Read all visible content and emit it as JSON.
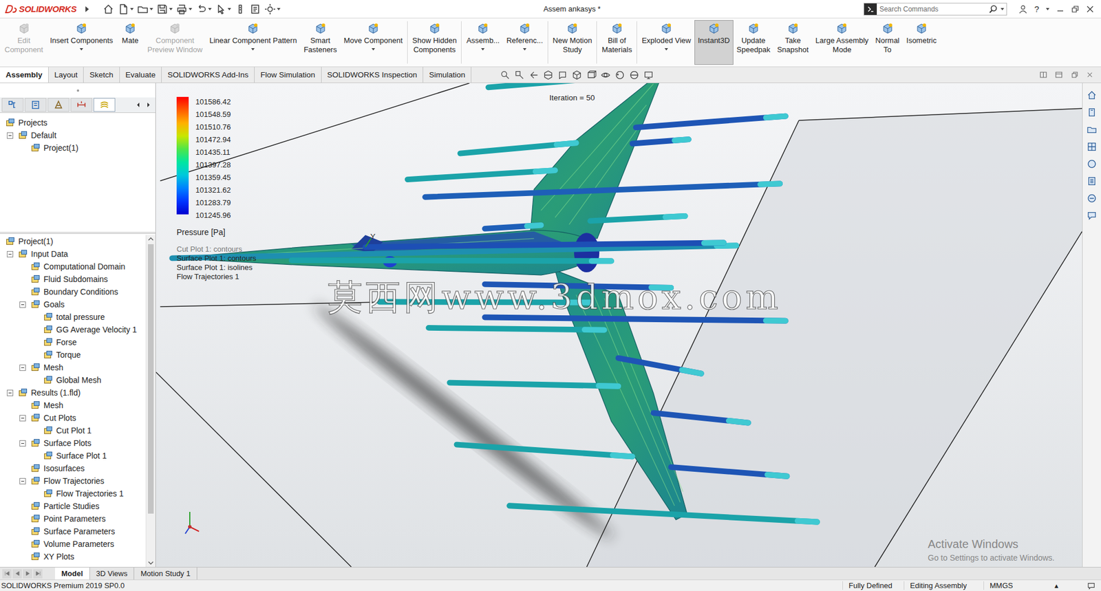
{
  "window": {
    "logo": "SOLIDWORKS",
    "title": "Assem ankasys *",
    "searchPlaceholder": "Search Commands",
    "help": "?"
  },
  "ribbon": [
    {
      "lines": [
        "Edit",
        "Component"
      ],
      "disabled": true,
      "selected": false,
      "hasMenu": false,
      "groupEnd": false
    },
    {
      "lines": [
        "Insert Components"
      ],
      "disabled": false,
      "selected": false,
      "hasMenu": true,
      "groupEnd": false
    },
    {
      "lines": [
        "Mate"
      ],
      "disabled": false,
      "selected": false,
      "hasMenu": false,
      "groupEnd": false
    },
    {
      "lines": [
        "Component",
        "Preview Window"
      ],
      "disabled": true,
      "selected": false,
      "hasMenu": false,
      "groupEnd": false
    },
    {
      "lines": [
        "Linear Component Pattern"
      ],
      "disabled": false,
      "selected": false,
      "hasMenu": true,
      "groupEnd": false
    },
    {
      "lines": [
        "Smart",
        "Fasteners"
      ],
      "disabled": false,
      "selected": false,
      "hasMenu": false,
      "groupEnd": false
    },
    {
      "lines": [
        "Move Component"
      ],
      "disabled": false,
      "selected": false,
      "hasMenu": true,
      "groupEnd": true
    },
    {
      "lines": [
        "Show Hidden",
        "Components"
      ],
      "disabled": false,
      "selected": false,
      "hasMenu": false,
      "groupEnd": true
    },
    {
      "lines": [
        "Assemb..."
      ],
      "disabled": false,
      "selected": false,
      "hasMenu": true,
      "groupEnd": false
    },
    {
      "lines": [
        "Referenc..."
      ],
      "disabled": false,
      "selected": false,
      "hasMenu": true,
      "groupEnd": true
    },
    {
      "lines": [
        "New Motion",
        "Study"
      ],
      "disabled": false,
      "selected": false,
      "hasMenu": false,
      "groupEnd": true
    },
    {
      "lines": [
        "Bill of",
        "Materials"
      ],
      "disabled": false,
      "selected": false,
      "hasMenu": false,
      "groupEnd": true
    },
    {
      "lines": [
        "Exploded View"
      ],
      "disabled": false,
      "selected": false,
      "hasMenu": true,
      "groupEnd": false
    },
    {
      "lines": [
        "Instant3D"
      ],
      "disabled": false,
      "selected": true,
      "hasMenu": false,
      "groupEnd": false
    },
    {
      "lines": [
        "Update",
        "Speedpak"
      ],
      "disabled": false,
      "selected": false,
      "hasMenu": false,
      "groupEnd": false
    },
    {
      "lines": [
        "Take",
        "Snapshot"
      ],
      "disabled": false,
      "selected": false,
      "hasMenu": false,
      "groupEnd": false
    },
    {
      "lines": [
        "Large Assembly",
        "Mode"
      ],
      "disabled": false,
      "selected": false,
      "hasMenu": false,
      "groupEnd": false
    },
    {
      "lines": [
        "Normal",
        "To"
      ],
      "disabled": false,
      "selected": false,
      "hasMenu": false,
      "groupEnd": false
    },
    {
      "lines": [
        "Isometric"
      ],
      "disabled": false,
      "selected": false,
      "hasMenu": false,
      "groupEnd": false
    }
  ],
  "tabs": [
    {
      "label": "Assembly",
      "selected": true
    },
    {
      "label": "Layout",
      "selected": false
    },
    {
      "label": "Sketch",
      "selected": false
    },
    {
      "label": "Evaluate",
      "selected": false
    },
    {
      "label": "SOLIDWORKS Add-Ins",
      "selected": false
    },
    {
      "label": "Flow Simulation",
      "selected": false
    },
    {
      "label": "SOLIDWORKS Inspection",
      "selected": false
    },
    {
      "label": "Simulation",
      "selected": false
    }
  ],
  "managerTabs": [
    {
      "selected": false
    },
    {
      "selected": false
    },
    {
      "selected": false
    },
    {
      "selected": false
    },
    {
      "selected": true
    }
  ],
  "projectTree": [
    {
      "label": "Projects",
      "depth": 0,
      "kind": "leaf",
      "expanded": false
    },
    {
      "label": "Default",
      "depth": 1,
      "kind": "branch",
      "expanded": true
    },
    {
      "label": "Project(1)",
      "depth": 2,
      "kind": "leaf",
      "expanded": false
    }
  ],
  "featureTree": [
    {
      "label": "Project(1)",
      "depth": 0,
      "kind": "leaf",
      "expanded": false
    },
    {
      "label": "Input Data",
      "depth": 1,
      "kind": "branch",
      "expanded": true
    },
    {
      "label": "Computational Domain",
      "depth": 2,
      "kind": "leaf",
      "expanded": false
    },
    {
      "label": "Fluid Subdomains",
      "depth": 2,
      "kind": "leaf",
      "expanded": false
    },
    {
      "label": "Boundary Conditions",
      "depth": 2,
      "kind": "leaf",
      "expanded": false
    },
    {
      "label": "Goals",
      "depth": 2,
      "kind": "branch",
      "expanded": true
    },
    {
      "label": "total pressure",
      "depth": 3,
      "kind": "leaf",
      "expanded": false
    },
    {
      "label": "GG Average Velocity 1",
      "depth": 3,
      "kind": "leaf",
      "expanded": false
    },
    {
      "label": "Forse",
      "depth": 3,
      "kind": "leaf",
      "expanded": false
    },
    {
      "label": "Torque",
      "depth": 3,
      "kind": "leaf",
      "expanded": false
    },
    {
      "label": "Mesh",
      "depth": 2,
      "kind": "branch",
      "expanded": true
    },
    {
      "label": "Global Mesh",
      "depth": 3,
      "kind": "leaf",
      "expanded": false
    },
    {
      "label": "Results (1.fld)",
      "depth": 1,
      "kind": "branch",
      "expanded": true
    },
    {
      "label": "Mesh",
      "depth": 2,
      "kind": "leaf",
      "expanded": false
    },
    {
      "label": "Cut Plots",
      "depth": 2,
      "kind": "branch",
      "expanded": true
    },
    {
      "label": "Cut Plot 1",
      "depth": 3,
      "kind": "leaf",
      "expanded": false
    },
    {
      "label": "Surface Plots",
      "depth": 2,
      "kind": "branch",
      "expanded": true
    },
    {
      "label": "Surface Plot 1",
      "depth": 3,
      "kind": "leaf",
      "expanded": false
    },
    {
      "label": "Isosurfaces",
      "depth": 2,
      "kind": "leaf",
      "expanded": false
    },
    {
      "label": "Flow Trajectories",
      "depth": 2,
      "kind": "branch",
      "expanded": true
    },
    {
      "label": "Flow Trajectories 1",
      "depth": 3,
      "kind": "leaf",
      "expanded": false
    },
    {
      "label": "Particle Studies",
      "depth": 2,
      "kind": "leaf",
      "expanded": false
    },
    {
      "label": "Point Parameters",
      "depth": 2,
      "kind": "leaf",
      "expanded": false
    },
    {
      "label": "Surface Parameters",
      "depth": 2,
      "kind": "leaf",
      "expanded": false
    },
    {
      "label": "Volume Parameters",
      "depth": 2,
      "kind": "leaf",
      "expanded": false
    },
    {
      "label": "XY Plots",
      "depth": 2,
      "kind": "leaf",
      "expanded": false
    }
  ],
  "featureScroll": {
    "level": 0.86
  },
  "viewport": {
    "iteration": "Iteration = 50",
    "axisLabel": "Y",
    "legend": {
      "values": [
        {
          "value": "101586.42",
          "color": "#ff0000"
        },
        {
          "value": "101548.59",
          "color": "#ff5a00"
        },
        {
          "value": "101510.76",
          "color": "#ffb000"
        },
        {
          "value": "101472.94",
          "color": "#c8e600"
        },
        {
          "value": "101435.11",
          "color": "#4ee64a"
        },
        {
          "value": "101397.28",
          "color": "#00e6a0"
        },
        {
          "value": "101359.45",
          "color": "#00c8dc"
        },
        {
          "value": "101321.62",
          "color": "#0080ff"
        },
        {
          "value": "101283.79",
          "color": "#0034ff"
        },
        {
          "value": "101245.96",
          "color": "#0000d0"
        }
      ],
      "unit": "Pressure [Pa]"
    },
    "plots": [
      {
        "label": "Cut Plot 1: contours",
        "dimmed": true
      },
      {
        "label": "Surface Plot 1: contours",
        "dimmed": false
      },
      {
        "label": "Surface Plot 1: isolines",
        "dimmed": false
      },
      {
        "label": "Flow Trajectories 1",
        "dimmed": false
      }
    ],
    "watermark": "莫西网www.3dmox.com",
    "activation": {
      "title": "Activate Windows",
      "subtitle": "Go to Settings to activate Windows."
    }
  },
  "bottomTabs": [
    {
      "label": "Model",
      "selected": true
    },
    {
      "label": "3D Views",
      "selected": false
    },
    {
      "label": "Motion Study 1",
      "selected": false
    }
  ],
  "statusBar": {
    "product": "SOLIDWORKS Premium 2019 SP0.0",
    "state": "Fully Defined",
    "mode": "Editing Assembly",
    "units": "MMGS",
    "unitsCaret": "▴"
  }
}
